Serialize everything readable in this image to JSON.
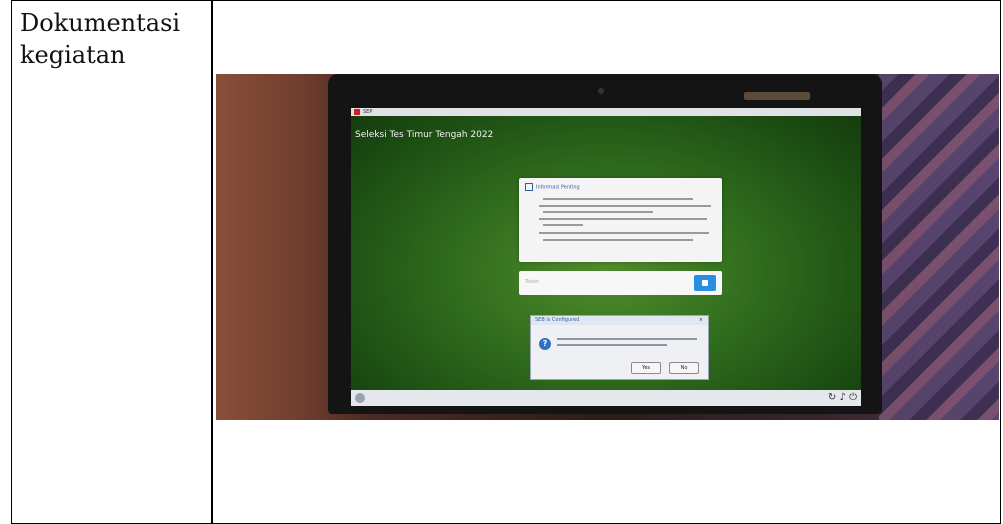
{
  "table": {
    "label": "Dokumentasi kegiatan"
  },
  "photo": {
    "screen": {
      "window_title": "SEP",
      "app_title": "Seleksi Tes Timur Tengah 2022",
      "notice_title": "Informasi Penting",
      "token_placeholder": "Token",
      "dialog_title": "SEB is Configured",
      "dialog_yes": "Yes",
      "dialog_no": "No"
    },
    "colors": {
      "screen_green": "#2e6a1c",
      "token_button": "#2a8ee0",
      "dialog_icon": "#2f6fc4"
    }
  }
}
